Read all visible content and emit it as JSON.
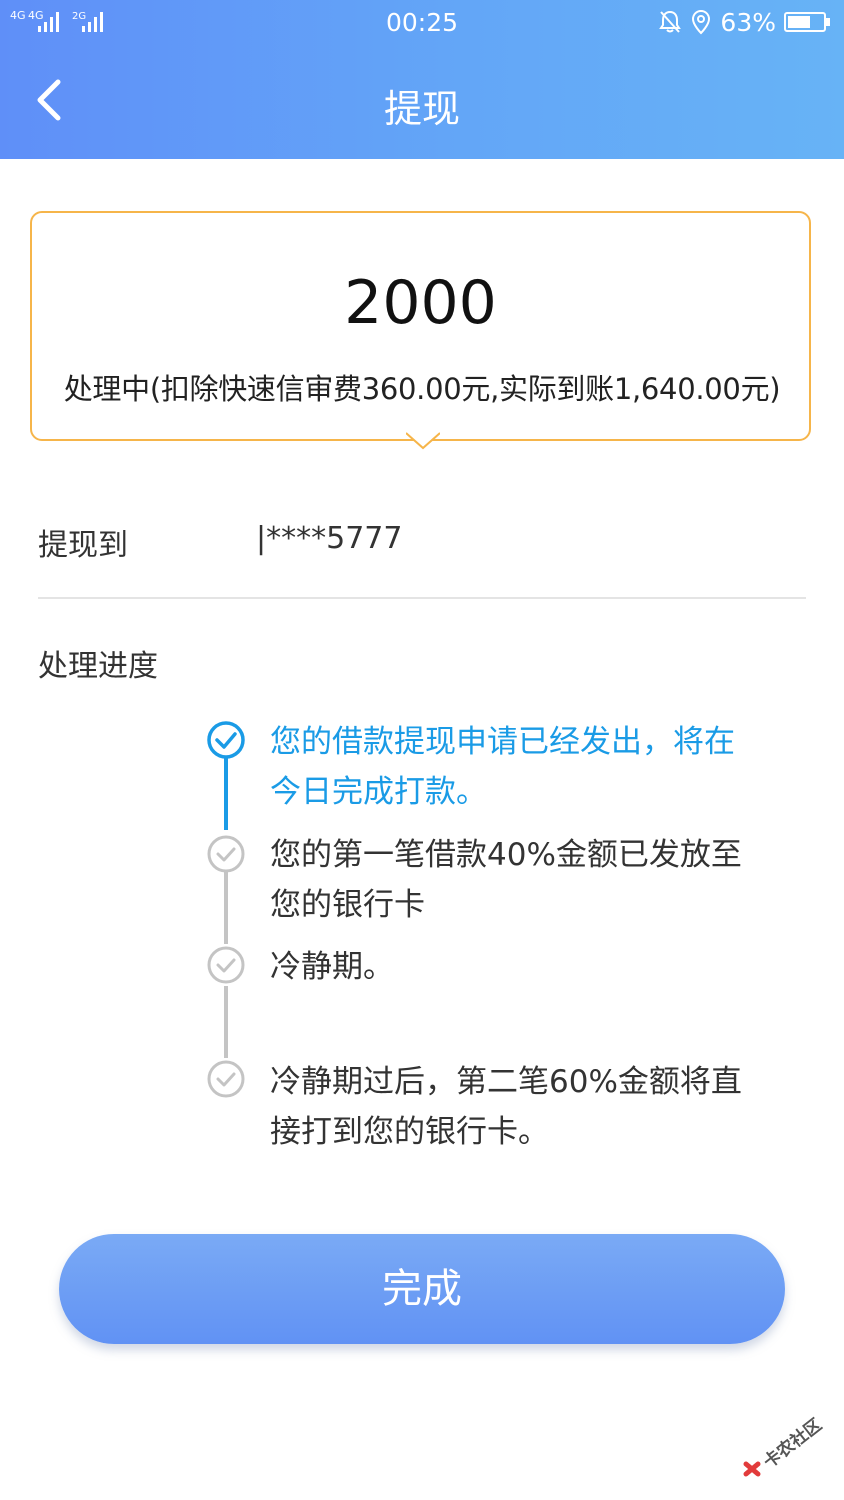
{
  "status_bar": {
    "network": "4G 4G 2G",
    "time": "00:25",
    "battery": "63%"
  },
  "nav": {
    "title": "提现"
  },
  "card": {
    "amount": "2000",
    "status": "处理中(扣除快速信审费360.00元,实际到账1,640.00元)"
  },
  "withdraw_to": {
    "label": "提现到",
    "value": "|****5777"
  },
  "progress": {
    "title": "处理进度",
    "steps": [
      {
        "line1": "您的借款提现申请已经发出，将在",
        "line2": "今日完成打款。",
        "state": "active"
      },
      {
        "line1": "您的第一笔借款40%金额已发放至",
        "line2": "您的银行卡",
        "state": "done"
      },
      {
        "line1": "冷静期。",
        "line2": "",
        "state": "done"
      },
      {
        "line1": "冷静期过后，第二笔60%金额将直",
        "line2": "接打到您的银行卡。",
        "state": "done"
      }
    ]
  },
  "button": {
    "label": "完成"
  },
  "watermark": {
    "text": "卡农社区"
  },
  "colors": {
    "header_start": "#5f8ff8",
    "header_end": "#67b3f6",
    "card_border": "#f6b54a",
    "active": "#1a9be6",
    "inactive": "#c4c4c4",
    "button": "#6d9ef5"
  }
}
